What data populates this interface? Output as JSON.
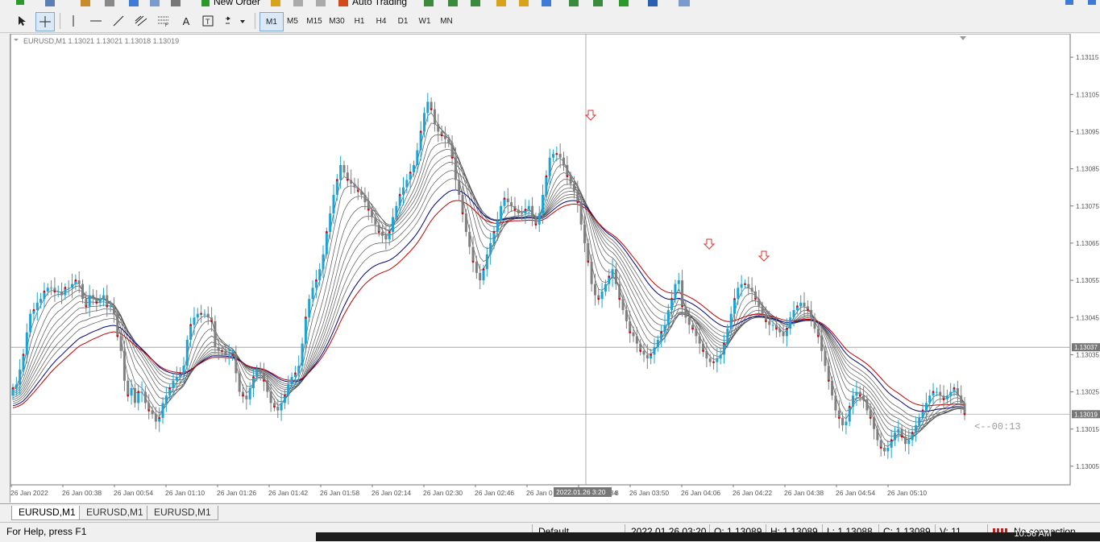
{
  "toolbar_top": {
    "new_order": "New Order",
    "auto_trading": "Auto Trading"
  },
  "toolbar_tools": {
    "timeframes": [
      "M1",
      "M5",
      "M15",
      "M30",
      "H1",
      "H4",
      "D1",
      "W1",
      "MN"
    ],
    "active_timeframe": "M1",
    "text_tool": "A"
  },
  "chart": {
    "title": "EURUSD,M1  1.13021 1.13021 1.13018 1.13019",
    "symbol": "EURUSD",
    "timeframe": "M1",
    "open": 1.13021,
    "high": 1.13021,
    "low": 1.13018,
    "close": 1.13019,
    "price_ticks": [
      "1.13115",
      "1.13105",
      "1.13095",
      "1.13085",
      "1.13075",
      "1.13065",
      "1.13055",
      "1.13045",
      "1.13035",
      "1.13025",
      "1.13015",
      "1.13005"
    ],
    "crosshair_price": "1.13037",
    "current_price": "1.13019",
    "time_labels": [
      "26 Jan 2022",
      "26 Jan 00:38",
      "26 Jan 00:54",
      "26 Jan 01:10",
      "26 Jan 01:26",
      "26 Jan 01:42",
      "26 Jan 01:58",
      "26 Jan 02:14",
      "26 Jan 02:30",
      "26 Jan 02:46",
      "26 Jan 0",
      "26 Jan 03:34",
      "26 Jan 03:50",
      "26 Jan 04:06",
      "26 Jan 04:22",
      "26 Jan 04:38",
      "26 Jan 04:54",
      "26 Jan 05:10"
    ],
    "crosshair_time": "2022.01.26 3:20",
    "crosshair_time_suffix": "8",
    "countdown": "<--00:13",
    "bull_color": "#1ba3d6",
    "bear_color": "#7f7f7f",
    "dot_color": "#e00000",
    "arrow_color": "#dd3333"
  },
  "chart_data": {
    "type": "candlestick",
    "ylim": [
      1.13,
      1.1312
    ],
    "close": [
      1.13026,
      1.13027,
      1.13031,
      1.13035,
      1.13041,
      1.13046,
      1.13047,
      1.13049,
      1.1305,
      1.13052,
      1.13053,
      1.13053,
      1.13052,
      1.13052,
      1.13051,
      1.13053,
      1.13053,
      1.13054,
      1.13055,
      1.13054,
      1.1305,
      1.13048,
      1.13051,
      1.1305,
      1.13049,
      1.1305,
      1.13051,
      1.13048,
      1.13048,
      1.13046,
      1.1304,
      1.13036,
      1.13028,
      1.13024,
      1.13026,
      1.13022,
      1.13025,
      1.13025,
      1.13022,
      1.1302,
      1.13019,
      1.13017,
      1.13018,
      1.13022,
      1.13024,
      1.13026,
      1.13028,
      1.13029,
      1.1303,
      1.13032,
      1.13039,
      1.13043,
      1.13045,
      1.13046,
      1.13046,
      1.13046,
      1.13045,
      1.13044,
      1.13037,
      1.13036,
      1.13036,
      1.13035,
      1.13035,
      1.13035,
      1.1303,
      1.13025,
      1.13024,
      1.13023,
      1.13026,
      1.13029,
      1.13031,
      1.1303,
      1.13028,
      1.13025,
      1.13022,
      1.13021,
      1.1302,
      1.13022,
      1.13024,
      1.13027,
      1.13029,
      1.1303,
      1.13032,
      1.13038,
      1.13045,
      1.1305,
      1.13053,
      1.13055,
      1.13058,
      1.13062,
      1.13068,
      1.13073,
      1.13078,
      1.13082,
      1.13086,
      1.13084,
      1.13082,
      1.13081,
      1.1308,
      1.13079,
      1.13078,
      1.13076,
      1.13074,
      1.13072,
      1.1307,
      1.13068,
      1.13067,
      1.13066,
      1.13068,
      1.13072,
      1.13075,
      1.13078,
      1.1308,
      1.13082,
      1.13084,
      1.13086,
      1.1309,
      1.13095,
      1.131,
      1.13103,
      1.13101,
      1.13097,
      1.13095,
      1.13094,
      1.13093,
      1.13092,
      1.13088,
      1.13082,
      1.13078,
      1.13073,
      1.13068,
      1.13064,
      1.1306,
      1.13057,
      1.13055,
      1.13058,
      1.13062,
      1.13065,
      1.13068,
      1.13071,
      1.13075,
      1.13077,
      1.13076,
      1.13075,
      1.13074,
      1.13073,
      1.13073,
      1.13074,
      1.13075,
      1.13072,
      1.1307,
      1.13073,
      1.13078,
      1.13083,
      1.13088,
      1.13089,
      1.13089,
      1.13088,
      1.13086,
      1.13083,
      1.13081,
      1.13079,
      1.13076,
      1.1307,
      1.13065,
      1.1306,
      1.13054,
      1.13051,
      1.1305,
      1.13052,
      1.13054,
      1.13056,
      1.13058,
      1.13054,
      1.1305,
      1.13047,
      1.13044,
      1.13041,
      1.1304,
      1.13038,
      1.13036,
      1.13035,
      1.13034,
      1.13035,
      1.13037,
      1.13039,
      1.13041,
      1.13043,
      1.13047,
      1.1305,
      1.13054,
      1.13055,
      1.13048,
      1.13045,
      1.13043,
      1.13042,
      1.1304,
      1.13038,
      1.13036,
      1.13034,
      1.13033,
      1.13033,
      1.13034,
      1.13035,
      1.13038,
      1.13042,
      1.13046,
      1.1305,
      1.13053,
      1.13054,
      1.13054,
      1.13053,
      1.13052,
      1.1305,
      1.13048,
      1.13046,
      1.13044,
      1.13043,
      1.13043,
      1.13042,
      1.13041,
      1.1304,
      1.13042,
      1.13045,
      1.13047,
      1.13048,
      1.13049,
      1.13048,
      1.13047,
      1.13045,
      1.13042,
      1.1304,
      1.13036,
      1.13032,
      1.13028,
      1.13024,
      1.1302,
      1.13018,
      1.13016,
      1.13017,
      1.13021,
      1.13024,
      1.13025,
      1.13024,
      1.13023,
      1.1302,
      1.13018,
      1.13015,
      1.13012,
      1.1301,
      1.13009,
      1.1301,
      1.13012,
      1.13014,
      1.13015,
      1.13013,
      1.13011,
      1.13012,
      1.13014,
      1.13016,
      1.13018,
      1.1302,
      1.13022,
      1.13024,
      1.13025,
      1.13025,
      1.13024,
      1.13023,
      1.13024,
      1.13025,
      1.13026,
      1.13024,
      1.13022,
      1.13019
    ]
  },
  "tabs": [
    "EURUSD,M1",
    "EURUSD,M1",
    "EURUSD,M1"
  ],
  "status": {
    "help": "For Help, press F1",
    "profile": "Default",
    "datetime": "2022.01.26 03:20",
    "open": "O: 1.13089",
    "high": "H: 1.13089",
    "low": "L: 1.13088",
    "close": "C: 1.13089",
    "volume": "V: 11",
    "connection": "No connection"
  },
  "taskbar": {
    "time": "10:56 AM"
  }
}
